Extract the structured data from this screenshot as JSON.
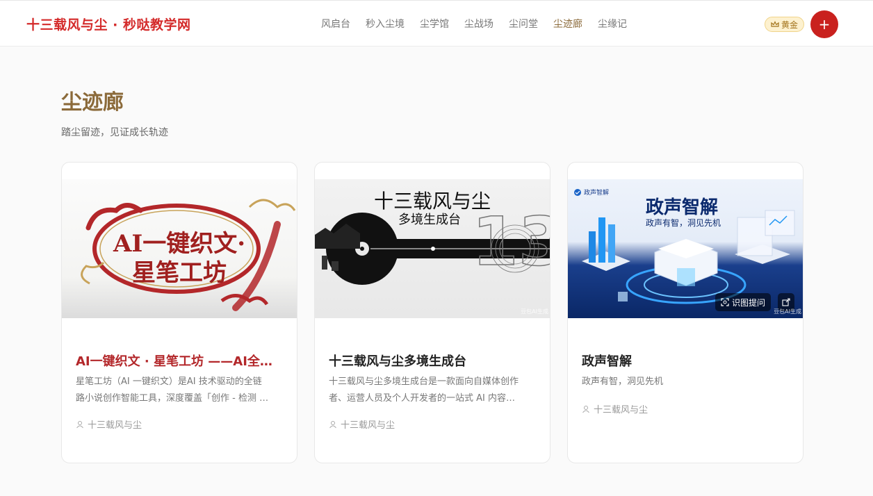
{
  "header": {
    "logo": "十三载风与尘 · 秒哒教学网",
    "nav": [
      "风启台",
      "秒入尘境",
      "尘学馆",
      "尘战场",
      "尘问堂",
      "尘迹廊",
      "尘缘记"
    ],
    "active_nav": "尘迹廊",
    "badge": "黄金",
    "avatar_symbol": "+"
  },
  "page": {
    "title": "尘迹廊",
    "subtitle": "踏尘留迹，见证成长轨迹"
  },
  "cards": [
    {
      "title": "AI一键织文 · 星笔工坊 ——AI全…",
      "desc_line1": "星笔工坊（AI 一键织文）是AI 技术驱动的全链",
      "desc_line2": "路小说创作智能工具，深度覆盖「创作 - 检测 …",
      "author": "十三载风与尘",
      "image_text_line1": "AI一键织文·",
      "image_text_line2": "星笔工坊"
    },
    {
      "title": "十三载风与尘多境生成台",
      "desc_line1": "十三载风与尘多境生成台是一款面向自媒体创作",
      "desc_line2": "者、运营人员及个人开发者的一站式 AI 内容…",
      "author": "十三载风与尘",
      "image_title": "十三载风与尘",
      "image_subtitle": "多境生成台",
      "image_number": "13",
      "watermark": "豆包AI生成"
    },
    {
      "title": "政声智解",
      "desc_line1": "政声有智，洞见先机",
      "author": "十三载风与尘",
      "image_logo": "政声智解",
      "image_title": "政声智解",
      "image_subtitle": "政声有智，洞见先机",
      "image_button": "识图提问",
      "watermark": "豆包AI生成"
    }
  ],
  "colors": {
    "brand_red": "#d42a2a",
    "gold_text": "#8b6a3a",
    "badge_bg": "#fdf1cf"
  }
}
